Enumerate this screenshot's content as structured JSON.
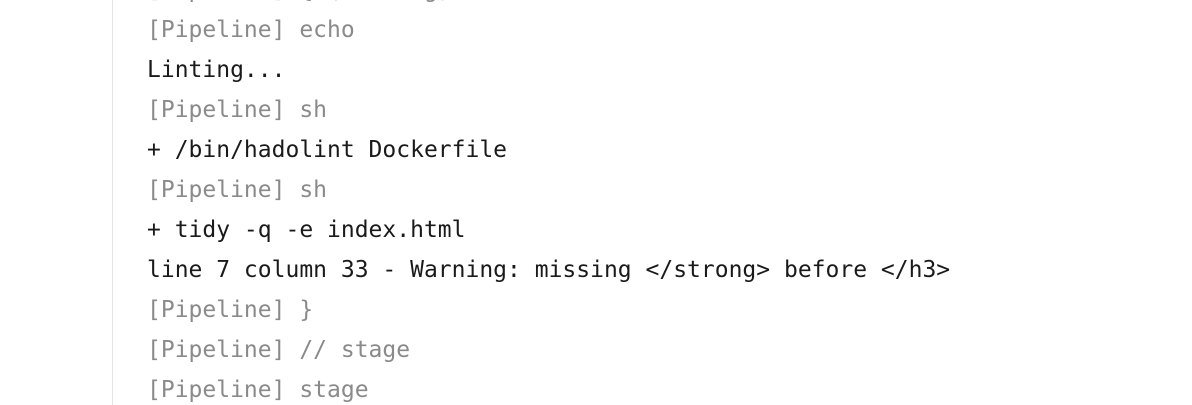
{
  "console": {
    "lines": [
      {
        "text": "[Pipeline] { (Linting)",
        "kind": "pipeline"
      },
      {
        "text": "[Pipeline] echo",
        "kind": "pipeline"
      },
      {
        "text": "Linting...",
        "kind": "output"
      },
      {
        "text": "[Pipeline] sh",
        "kind": "pipeline"
      },
      {
        "text": "+ /bin/hadolint Dockerfile",
        "kind": "output"
      },
      {
        "text": "[Pipeline] sh",
        "kind": "pipeline"
      },
      {
        "text": "+ tidy -q -e index.html",
        "kind": "output"
      },
      {
        "text": "line 7 column 33 - Warning: missing </strong> before </h3>",
        "kind": "output"
      },
      {
        "text": "[Pipeline] }",
        "kind": "pipeline"
      },
      {
        "text": "[Pipeline] // stage",
        "kind": "pipeline"
      },
      {
        "text": "[Pipeline] stage",
        "kind": "pipeline"
      }
    ]
  },
  "colors": {
    "pipeline_text": "#8a8a8a",
    "output_text": "#1a1a1a",
    "border": "#e4e4e4"
  }
}
